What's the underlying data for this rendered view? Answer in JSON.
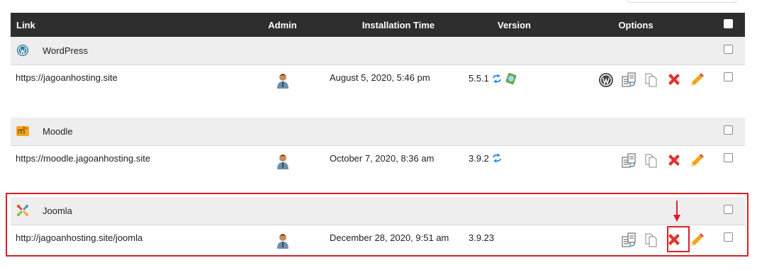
{
  "header": {
    "link": "Link",
    "admin": "Admin",
    "time": "Installation Time",
    "version": "Version",
    "options": "Options"
  },
  "groups": [
    {
      "name": "WordPress",
      "icon": "wordpress-icon",
      "url": "https://jagoanhosting.site",
      "installed": "August 5, 2020, 5:46 pm",
      "version": "5.5.1",
      "icons": [
        "admin-user-icon",
        "update-icon",
        "staging-icon",
        "wordpress-manage-icon",
        "clone-icon",
        "copy-icon",
        "remove-icon",
        "edit-icon"
      ]
    },
    {
      "name": "Moodle",
      "icon": "moodle-icon",
      "url": "https://moodle.jagoanhosting.site",
      "installed": "October 7, 2020, 8:36 am",
      "version": "3.9.2",
      "icons": [
        "admin-user-icon",
        "update-icon",
        "clone-icon",
        "copy-icon",
        "remove-icon",
        "edit-icon"
      ]
    },
    {
      "name": "Joomla",
      "icon": "joomla-icon",
      "url": "http://jagoanhosting.site/joomla",
      "installed": "December 28, 2020, 9:51 am",
      "version": "3.9.23",
      "icons": [
        "admin-user-icon",
        "clone-icon",
        "copy-icon",
        "remove-icon",
        "edit-icon"
      ]
    }
  ],
  "colors": {
    "header_bg": "#2e2e2e",
    "group_bg": "#eeeeee",
    "highlight": "#d91f26",
    "remove": "#e2332b",
    "edit": "#f2a516",
    "update": "#2b8fe0"
  }
}
